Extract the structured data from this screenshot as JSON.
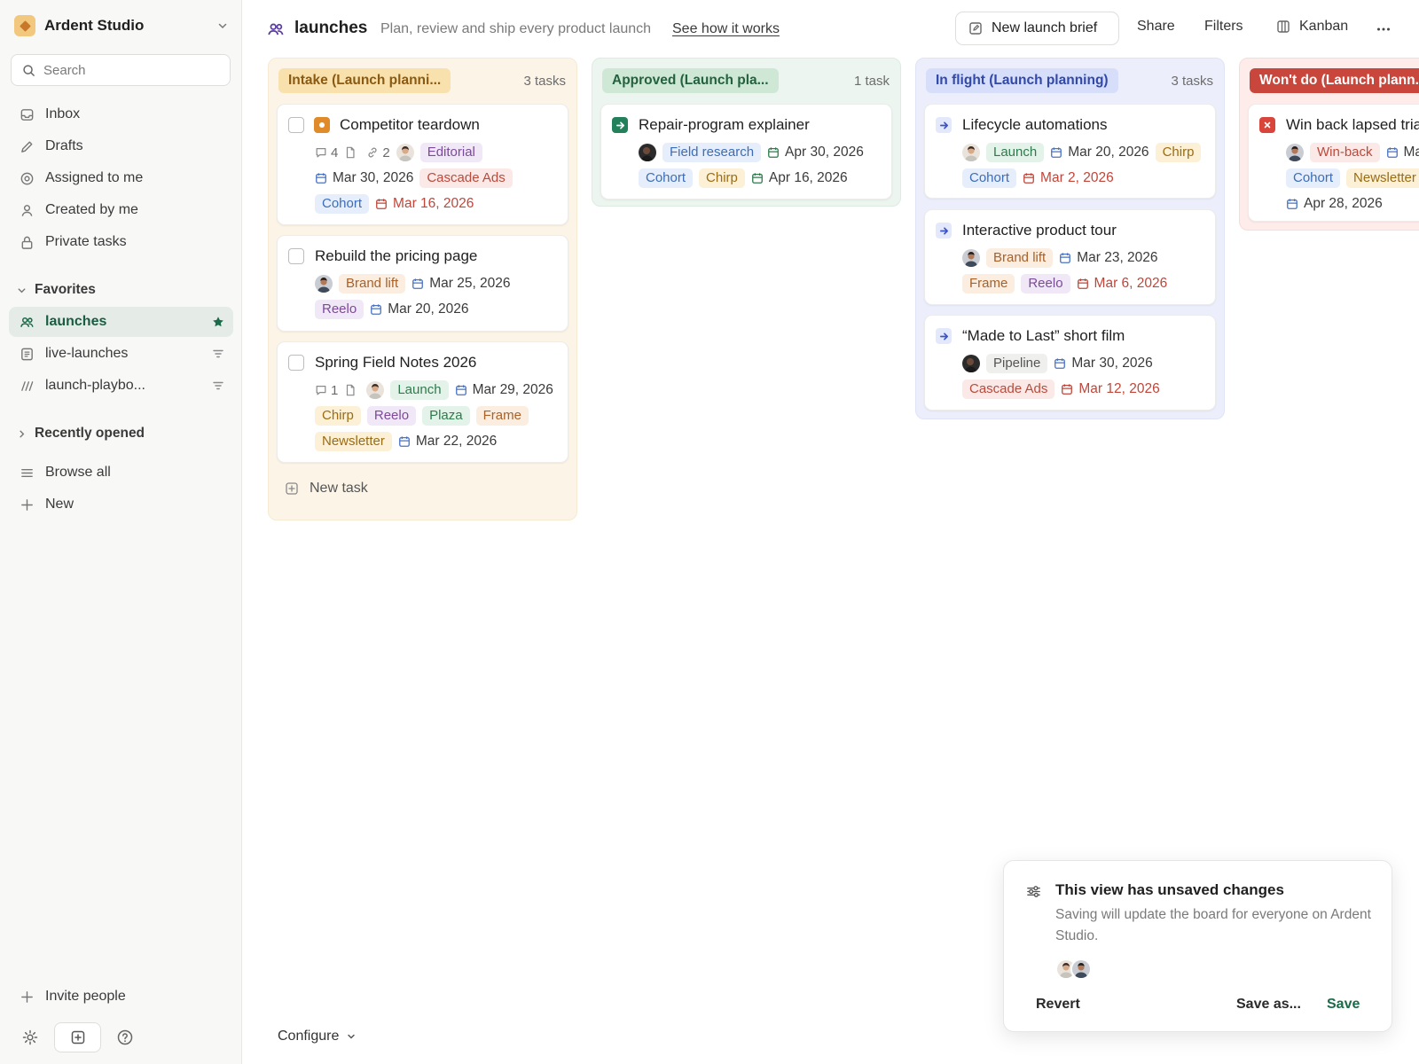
{
  "workspace": {
    "name": "Ardent Studio"
  },
  "search": {
    "placeholder": "Search"
  },
  "nav": {
    "inbox": "Inbox",
    "drafts": "Drafts",
    "assigned": "Assigned to me",
    "created": "Created by me",
    "private": "Private tasks",
    "browse_all": "Browse all",
    "new": "New",
    "invite": "Invite people"
  },
  "favorites": {
    "label": "Favorites",
    "items": [
      "launches",
      "live-launches",
      "launch-playbo..."
    ]
  },
  "recent": {
    "label": "Recently opened"
  },
  "header": {
    "title": "launches",
    "description": "Plan, review and ship every product launch",
    "link": "See how it works",
    "new_brief": "New launch brief",
    "share": "Share",
    "filters": "Filters",
    "view": "Kanban"
  },
  "columns": [
    {
      "title": "Intake (Launch planni...",
      "count": "3 tasks",
      "new_task": "New task",
      "cards": [
        {
          "title": "Competitor teardown",
          "comments": "4",
          "links": "2",
          "tags": [
            "Editorial",
            "Cascade Ads",
            "Cohort"
          ],
          "dates": [
            "Mar 30, 2026",
            "Mar 16, 2026"
          ]
        },
        {
          "title": "Rebuild the pricing page",
          "tags": [
            "Brand lift",
            "Reelo"
          ],
          "dates": [
            "Mar 25, 2026",
            "Mar 20, 2026"
          ]
        },
        {
          "title": "Spring Field Notes 2026",
          "comments": "1",
          "tags": [
            "Launch",
            "Chirp",
            "Reelo",
            "Plaza",
            "Frame",
            "Newsletter"
          ],
          "dates": [
            "Mar 29, 2026",
            "Mar 22, 2026"
          ]
        }
      ]
    },
    {
      "title": "Approved (Launch pla...",
      "count": "1 task",
      "cards": [
        {
          "title": "Repair-program explainer",
          "tags": [
            "Field research",
            "Cohort",
            "Chirp"
          ],
          "dates": [
            "Apr 30, 2026",
            "Apr 16, 2026"
          ]
        }
      ]
    },
    {
      "title": "In flight (Launch planning)",
      "count": "3 tasks",
      "cards": [
        {
          "title": "Lifecycle automations",
          "tags": [
            "Launch",
            "Chirp",
            "Cohort"
          ],
          "dates": [
            "Mar 20, 2026",
            "Mar 2, 2026"
          ]
        },
        {
          "title": "Interactive product tour",
          "tags": [
            "Brand lift",
            "Frame",
            "Reelo"
          ],
          "dates": [
            "Mar 23, 2026",
            "Mar 6, 2026"
          ]
        },
        {
          "title": "“Made to Last” short film",
          "tags": [
            "Pipeline",
            "Cascade Ads"
          ],
          "dates": [
            "Mar 30, 2026",
            "Mar 12, 2026"
          ]
        }
      ]
    },
    {
      "title": "Won't do (Launch plann...",
      "cards": [
        {
          "title": "Win back lapsed tria",
          "tags": [
            "Win-back",
            "Cohort",
            "Newsletter"
          ],
          "dates": [
            "Ma",
            "Apr 28, 2026"
          ]
        }
      ]
    }
  ],
  "footer": {
    "configure": "Configure"
  },
  "toast": {
    "title": "This view has unsaved changes",
    "description": "Saving will update the board for everyone on Ardent Studio.",
    "revert": "Revert",
    "save_as": "Save as...",
    "save": "Save"
  },
  "colors": {
    "accent": "#1a6b4a",
    "intake_bg": "#fcf4e6",
    "intake_pill": "#f8e1ad",
    "approved_bg": "#ecf5ef",
    "approved_pill": "#cfe8d6",
    "inflight_bg": "#eceffb",
    "inflight_pill": "#d7defa",
    "wontdo_bg": "#fdecea",
    "wontdo_pill": "#c8463b"
  }
}
